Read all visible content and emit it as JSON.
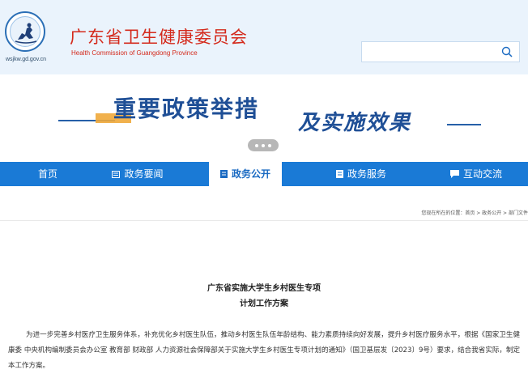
{
  "header": {
    "org_name_cn": "广东省卫生健康委员会",
    "org_name_en": "Health Commission of Guangdong Province",
    "domain": "wsjkw.gd.gov.cn",
    "search_placeholder": ""
  },
  "banner": {
    "title_part1": "重要政策举措",
    "title_part2": "及实施效果"
  },
  "nav": {
    "items": [
      {
        "label": "首页",
        "icon": "none"
      },
      {
        "label": "政务要闻",
        "icon": "news-icon"
      },
      {
        "label": "政务公开",
        "icon": "document-icon"
      },
      {
        "label": "政务服务",
        "icon": "service-icon"
      },
      {
        "label": "互动交流",
        "icon": "chat-icon"
      }
    ],
    "active_index": 2
  },
  "breadcrumb": "您现在所在的位置：首页 > 政务公开 > 部门文件",
  "document": {
    "title_line1": "广东省实施大学生乡村医生专项",
    "title_line2": "计划工作方案",
    "body": "为进一步完善乡村医疗卫生服务体系，补充优化乡村医生队伍，推动乡村医生队伍年龄结构、能力素质持续向好发展，提升乡村医疗服务水平，根据《国家卫生健康委 中央机构编制委员会办公室 教育部 财政部 人力资源社会保障部关于实施大学生乡村医生专项计划的通知》（国卫基层发〔2023〕9号）要求，结合我省实际，制定本工作方案。"
  },
  "colors": {
    "nav_bg": "#1a7ad6",
    "org_red": "#d42a1c",
    "banner_blue": "#1f4f96",
    "header_bg": "#eaf3fc"
  }
}
